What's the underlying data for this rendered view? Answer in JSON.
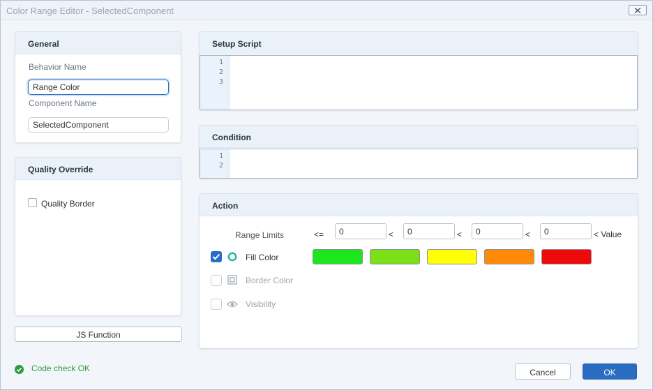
{
  "window": {
    "title": "Color Range Editor - SelectedComponent"
  },
  "general": {
    "header": "General",
    "behavior_name_label": "Behavior Name",
    "behavior_name_value": "Range Color",
    "component_name_label": "Component Name",
    "component_name_value": "SelectedComponent"
  },
  "quality": {
    "header": "Quality Override",
    "border_label": "Quality Border",
    "border_checked": false
  },
  "js_button": "JS Function",
  "status": {
    "text": "Code check OK",
    "color": "#2e9b3e"
  },
  "setup": {
    "header": "Setup Script",
    "lines": [
      "1",
      "2",
      "3"
    ]
  },
  "condition": {
    "header": "Condition",
    "lines": [
      "1",
      "2"
    ]
  },
  "action": {
    "header": "Action",
    "range_limits_label": "Range Limits",
    "ops": [
      "<=",
      "<",
      "<",
      "<",
      "< Value"
    ],
    "limits": [
      "0",
      "0",
      "0",
      "0"
    ],
    "rows": [
      {
        "label": "Fill Color",
        "checked": true,
        "enabled": true,
        "icon": "radio-ring-icon"
      },
      {
        "label": "Border Color",
        "checked": false,
        "enabled": false,
        "icon": "square-frame-icon"
      },
      {
        "label": "Visibility",
        "checked": false,
        "enabled": false,
        "icon": "eye-icon"
      }
    ],
    "colors": [
      "#1ee61e",
      "#7be01a",
      "#ffff0a",
      "#ff8a0a",
      "#ee0a0a"
    ]
  },
  "buttons": {
    "cancel": "Cancel",
    "ok": "OK"
  }
}
